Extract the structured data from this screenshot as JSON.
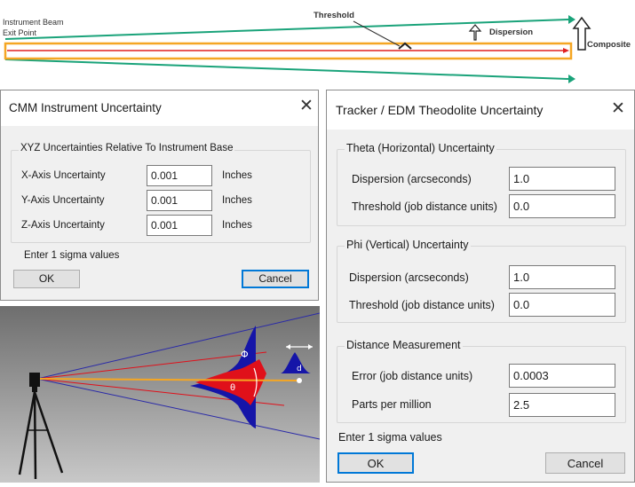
{
  "diagram": {
    "exit_label_line1": "Instrument Beam",
    "exit_label_line2": "Exit Point",
    "threshold_label": "Threshold",
    "dispersion_label": "Dispersion",
    "composite_label": "Composite"
  },
  "cmm_dialog": {
    "title": "CMM Instrument Uncertainty",
    "group_label": "XYZ Uncertainties Relative To Instrument Base",
    "rows": [
      {
        "label": "X-Axis Uncertainty",
        "value": "0.001",
        "unit": "Inches"
      },
      {
        "label": "Y-Axis Uncertainty",
        "value": "0.001",
        "unit": "Inches"
      },
      {
        "label": "Z-Axis Uncertainty",
        "value": "0.001",
        "unit": "Inches"
      }
    ],
    "note": "Enter 1 sigma values",
    "ok_label": "OK",
    "cancel_label": "Cancel"
  },
  "tracker_dialog": {
    "title": "Tracker / EDM Theodolite Uncertainty",
    "theta": {
      "group_label": "Theta (Horizontal) Uncertainty",
      "dispersion_label": "Dispersion (arcseconds)",
      "dispersion_value": "1.0",
      "threshold_label": "Threshold (job distance units)",
      "threshold_value": "0.0"
    },
    "phi": {
      "group_label": "Phi (Vertical) Uncertainty",
      "dispersion_label": "Dispersion (arcseconds)",
      "dispersion_value": "1.0",
      "threshold_label": "Threshold (job distance units)",
      "threshold_value": "0.0"
    },
    "distance": {
      "group_label": "Distance Measurement",
      "error_label": "Error (job distance units)",
      "error_value": "0.0003",
      "ppm_label": "Parts per million",
      "ppm_value": "2.5"
    },
    "note": "Enter 1 sigma values",
    "ok_label": "OK",
    "cancel_label": "Cancel"
  },
  "illustration": {
    "phi_symbol": "Φ",
    "theta_symbol": "θ",
    "distance_symbol": "d"
  },
  "colors": {
    "beam_green": "#1aa37a",
    "beam_orange": "#f5a623",
    "beam_red": "#e02020",
    "focus_blue": "#0078d7",
    "distribution_blue": "#1515a8",
    "distribution_red": "#e0101a"
  }
}
